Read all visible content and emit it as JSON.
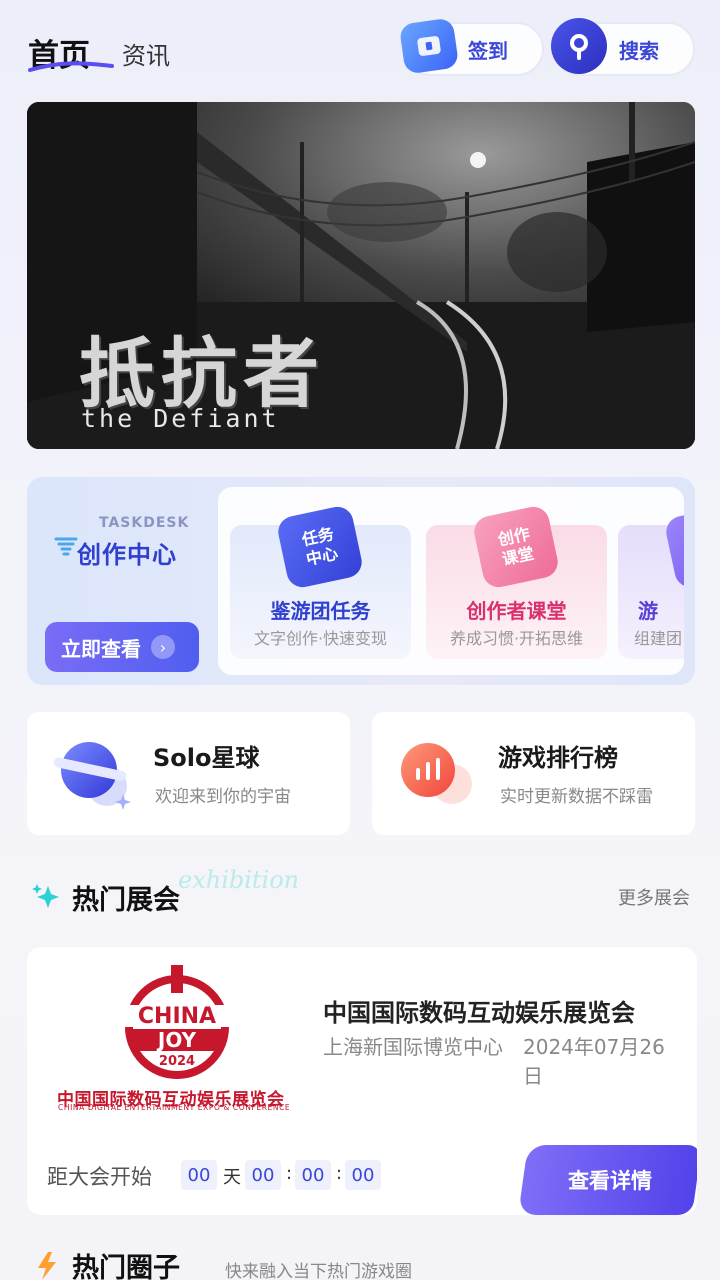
{
  "header": {
    "tabs": [
      {
        "label": "首页",
        "active": true
      },
      {
        "label": "资讯",
        "active": false
      }
    ],
    "signin_label": "签到",
    "search_label": "搜索"
  },
  "banner": {
    "title": "抵抗者",
    "subtitle": "the Defiant"
  },
  "creator_center": {
    "label_en": "TASKDESK",
    "title": "创作中心",
    "button_label": "立即查看",
    "cards": [
      {
        "badge": "任务\n中心",
        "title": "鉴游团任务",
        "desc": "文字创作·快速变现"
      },
      {
        "badge": "创作\n课堂",
        "title": "创作者课堂",
        "desc": "养成习惯·开拓思维"
      },
      {
        "badge": "",
        "title": "游",
        "desc": "组建团"
      }
    ]
  },
  "features": [
    {
      "title": "Solo星球",
      "subtitle": "欢迎来到你的宇宙",
      "icon": "planet-icon"
    },
    {
      "title": "游戏排行榜",
      "subtitle": "实时更新数据不踩雷",
      "icon": "ranking-chart-icon"
    }
  ],
  "hot_expo": {
    "section_title": "热门展会",
    "watermark": "exhibition",
    "more_label": "更多展会",
    "card": {
      "logo_text": "中国国际数码互动娱乐展览会",
      "logo_en": "CHINA DIGITAL ENTERTAINMENT EXPO & CONFERENCE",
      "logo_year": "2024",
      "title": "中国国际数码互动娱乐展览会",
      "venue": "上海新国际博览中心",
      "date": "2024年07月26日",
      "countdown_label": "距大会开始",
      "countdown": {
        "days": "00",
        "day_unit": "天",
        "hours": "00",
        "minutes": "00",
        "seconds": "00",
        "sep": ":"
      },
      "button_label": "查看详情"
    }
  },
  "hot_circles": {
    "title": "热门圈子",
    "subtitle": "快来融入当下热门游戏圈"
  },
  "colors": {
    "accent": "#3b47d6",
    "button_gradient_start": "#7f6ef7",
    "button_gradient_end": "#5242ea",
    "expo_red": "#c6172d"
  }
}
